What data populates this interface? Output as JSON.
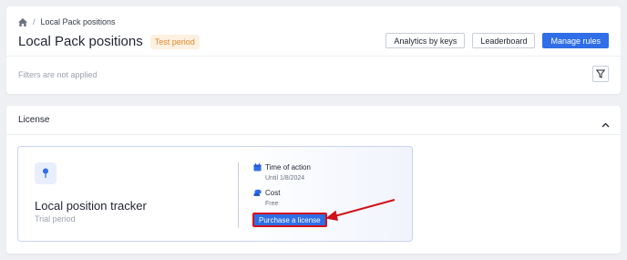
{
  "breadcrumb": {
    "home_icon": "home-icon",
    "current": "Local Pack positions"
  },
  "header": {
    "title": "Local Pack positions",
    "badge": "Test period",
    "buttons": {
      "analytics": "Analytics by keys",
      "leaderboard": "Leaderboard",
      "manage_rules": "Manage rules"
    },
    "accent_color": "#2f6ee6",
    "badge_color": "#e08a2e"
  },
  "filters": {
    "status": "Filters are not applied",
    "icon": "filter-icon"
  },
  "license": {
    "section_title": "License",
    "collapse_icon": "chevron-up-icon",
    "tracker": {
      "icon": "pin-icon",
      "name": "Local position tracker",
      "subtitle": "Trial period",
      "time_label": "Time of action",
      "time_icon": "calendar-icon",
      "time_value": "Until 1/8/2024",
      "cost_label": "Cost",
      "cost_icon": "coins-icon",
      "cost_value": "Free",
      "purchase_label": "Purchase a license"
    },
    "highlight_color": "#d0121b"
  }
}
